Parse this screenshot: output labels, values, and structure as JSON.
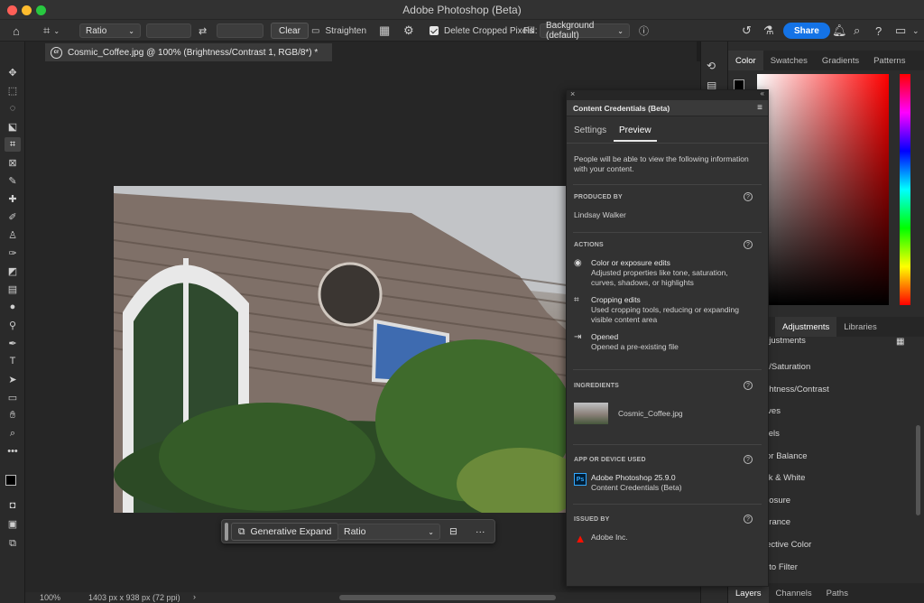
{
  "window": {
    "title": "Adobe Photoshop (Beta)"
  },
  "options_bar": {
    "ratio_select": "Ratio",
    "clear_label": "Clear",
    "straighten_label": "Straighten",
    "delete_cropped_label": "Delete Cropped Pixels",
    "fill_label": "Fill:",
    "fill_value": "Background (default)",
    "share_label": "Share"
  },
  "document": {
    "tab_label": "Cosmic_Coffee.jpg @ 100% (Brightness/Contrast 1, RGB/8*) *"
  },
  "context_bar": {
    "generative_expand_label": "Generative Expand",
    "ratio_select": "Ratio",
    "more_label": "···"
  },
  "status_bar": {
    "zoom": "100%",
    "doc_info": "1403 px x 938 px (72 ppi)"
  },
  "right_panel": {
    "color_tabs": [
      "Color",
      "Swatches",
      "Gradients",
      "Patterns"
    ],
    "adjust_tabs": [
      "Adjustments",
      "Libraries"
    ],
    "adjustment_items": [
      "djustments",
      "e/Saturation",
      "ghtness/Contrast",
      "rves",
      "vels",
      "lor Balance",
      "ck & White",
      "posure",
      "brance",
      "lective Color",
      "oto Filter"
    ],
    "bottom_tabs": [
      "Layers",
      "Channels",
      "Paths"
    ]
  },
  "content_credentials": {
    "title": "Content Credentials (Beta)",
    "tabs": [
      "Settings",
      "Preview"
    ],
    "intro": "People will be able to view the following information with your content.",
    "produced_by": {
      "label": "PRODUCED BY",
      "value": "Lindsay Walker"
    },
    "actions": {
      "label": "ACTIONS",
      "items": [
        {
          "title": "Color or exposure edits",
          "desc": "Adjusted properties like tone, saturation, curves, shadows, or highlights"
        },
        {
          "title": "Cropping edits",
          "desc": "Used cropping tools, reducing or expanding visible content area"
        },
        {
          "title": "Opened",
          "desc": "Opened a pre-existing file"
        }
      ]
    },
    "ingredients": {
      "label": "INGREDIENTS",
      "file": "Cosmic_Coffee.jpg"
    },
    "app": {
      "label": "APP OR DEVICE USED",
      "name": "Adobe Photoshop 25.9.0",
      "sub": "Content Credentials (Beta)"
    },
    "issued_by": {
      "label": "ISSUED BY",
      "value": "Adobe Inc."
    }
  },
  "colors": {
    "accent": "#1473e6",
    "panel_bg": "#323232",
    "app_bg": "#1e1e1e"
  }
}
